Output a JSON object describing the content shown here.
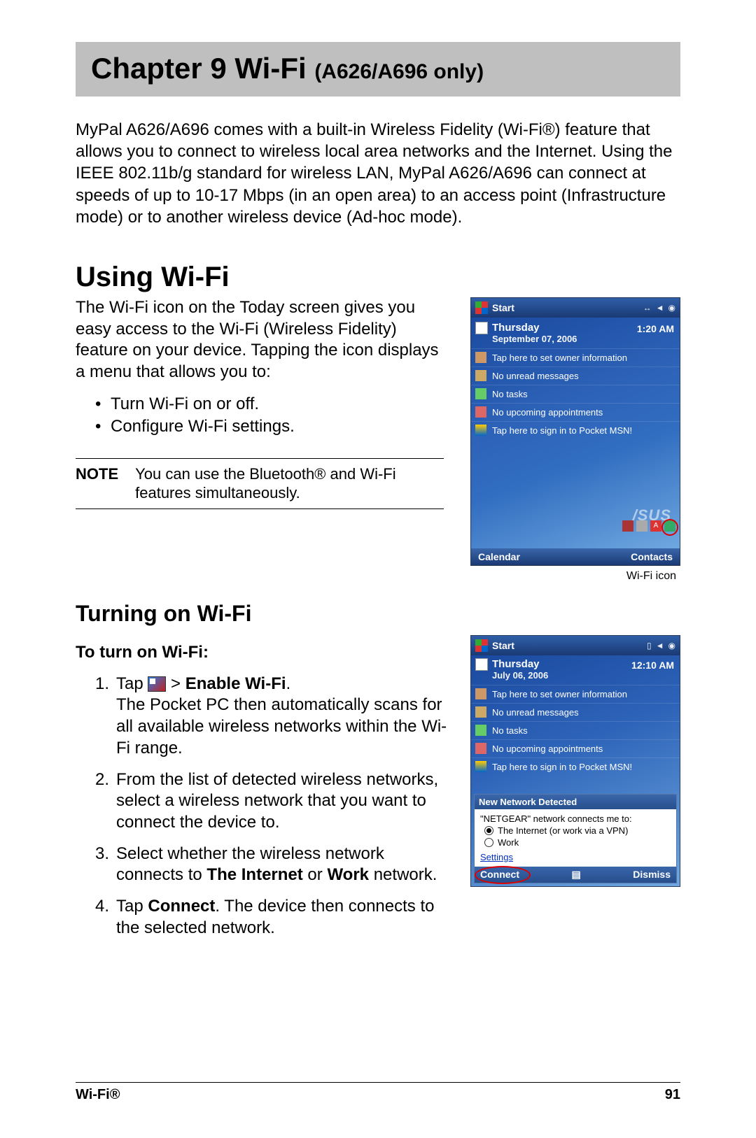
{
  "chapter": {
    "title": "Chapter 9  Wi-Fi ",
    "subtitle": "(A626/A696 only)"
  },
  "intro": "MyPal A626/A696 comes with a built-in Wireless Fidelity (Wi-Fi®) feature that allows you to connect to wireless local area networks and the Internet. Using the IEEE 802.11b/g standard for wireless LAN, MyPal A626/A696 can connect at speeds of up to 10-17 Mbps (in an open area) to an access point (Infrastructure mode) or to another wireless device (Ad-hoc mode).",
  "section1": {
    "heading": "Using Wi-Fi",
    "para": "The Wi-Fi icon on the Today screen gives you easy access to the Wi-Fi (Wireless Fidelity) feature on your device. Tapping the icon displays a menu that allows you to:",
    "bullets": [
      "Turn Wi-Fi on or off.",
      "Configure Wi-Fi settings."
    ],
    "note_label": "NOTE",
    "note_text": "You can use the Bluetooth® and Wi-Fi features simultaneously.",
    "caption": "Wi-Fi icon"
  },
  "shot1": {
    "start": "Start",
    "day": "Thursday",
    "date": "September 07, 2006",
    "time": "1:20 AM",
    "items": [
      "Tap here to set owner information",
      "No unread messages",
      "No tasks",
      "No upcoming appointments",
      "Tap here to sign in to Pocket MSN!"
    ],
    "brand": "/SUS",
    "tray_a": "A",
    "footer_left": "Calendar",
    "footer_right": "Contacts"
  },
  "section2": {
    "heading": "Turning on Wi-Fi",
    "subheading": "To turn on Wi-Fi:",
    "steps": {
      "s1_pre": "Tap ",
      "s1_mid": " > ",
      "s1_bold": "Enable Wi-Fi",
      "s1_post": ".",
      "s1_body": "The Pocket PC then automatically scans for all available wireless networks within the Wi-Fi range.",
      "s2": "From the list of detected wireless networks, select a wireless network that you want to connect the device to.",
      "s3_pre": "Select whether the wireless network connects to ",
      "s3_b1": "The Internet",
      "s3_mid": " or ",
      "s3_b2": "Work",
      "s3_post": " network.",
      "s4_pre": "Tap ",
      "s4_b": "Connect",
      "s4_post": ". The device then connects to the selected network."
    }
  },
  "shot2": {
    "start": "Start",
    "day": "Thursday",
    "date": "July 06, 2006",
    "time": "12:10 AM",
    "items": [
      "Tap here to set owner information",
      "No unread messages",
      "No tasks",
      "No upcoming appointments",
      "Tap here to sign in to Pocket MSN!"
    ],
    "popup_title": "New Network Detected",
    "popup_msg": "\"NETGEAR\" network connects me to:",
    "opt1": "The Internet (or work via a VPN)",
    "opt2": "Work",
    "settings": "Settings",
    "connect": "Connect",
    "dismiss": "Dismiss"
  },
  "footer": {
    "left": "Wi-Fi®",
    "right": "91"
  }
}
